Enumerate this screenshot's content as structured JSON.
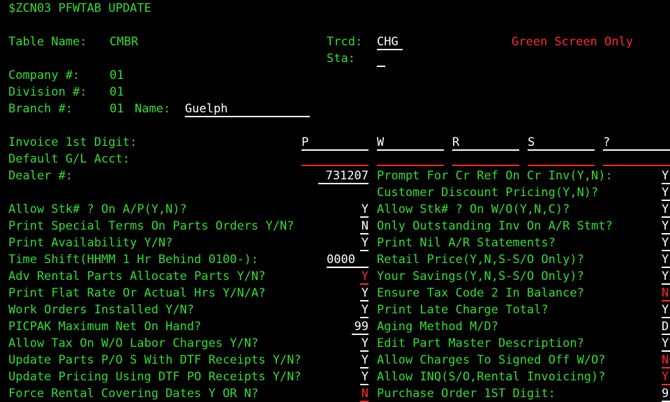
{
  "screen_title": "$ZCN03 PFWTAB UPDATE",
  "header": {
    "table_name_label": "Table Name:",
    "table_name_value": "CMBR",
    "trcd_label": "Trcd:",
    "trcd_value": "CHG",
    "sta_label": "Sta:",
    "sta_value": "",
    "notice": "Green Screen Only",
    "company_label": "Company #:",
    "company_value": "01",
    "division_label": "Division #:",
    "division_value": "01",
    "branch_label": "Branch #:",
    "branch_value": "01",
    "name_label": "Name:",
    "name_value": "Guelph"
  },
  "invoice": {
    "label": "Invoice 1st Digit:",
    "digits": [
      "P",
      "W",
      "R",
      "S",
      "?"
    ]
  },
  "gl_label": "Default G/L Acct:",
  "dealer": {
    "label": "Dealer #:",
    "value": "731207"
  },
  "left_options": [
    {
      "label": "Allow Stk# ? On A/P(Y,N)?",
      "value": "Y"
    },
    {
      "label": "Print Special Terms On Parts Orders Y/N?",
      "value": "N"
    },
    {
      "label": "Print Availability Y/N?",
      "value": "Y"
    },
    {
      "label": "Time Shift(HHMM 1 Hr Behind 0100-):",
      "value": "0000"
    },
    {
      "label": "Adv Rental Parts Allocate Parts Y/N?",
      "value": "Y"
    },
    {
      "label": "Print Flat Rate Or Actual Hrs Y/N/A?",
      "value": "Y"
    },
    {
      "label": "Work Orders Installed Y/N?",
      "value": "Y"
    },
    {
      "label": "PICPAK Maximum Net On Hand?",
      "value": "99"
    },
    {
      "label": "Allow Tax On W/O Labor Charges Y/N?",
      "value": "Y"
    },
    {
      "label": "Update Parts P/O S With DTF Receipts Y/N?",
      "value": "Y"
    },
    {
      "label": "Update Pricing Using DTF PO Receipts Y/N?",
      "value": "Y"
    },
    {
      "label": "Force Rental Covering Dates Y OR N?",
      "value": "N"
    }
  ],
  "right_options": [
    {
      "label": "Prompt For Cr Ref On Cr Inv(Y,N):",
      "value": "Y"
    },
    {
      "label": "Customer Discount Pricing(Y,N)?",
      "value": "Y"
    },
    {
      "label": "Allow Stk# ? On W/O(Y,N,C)?",
      "value": "Y"
    },
    {
      "label": "Only Outstanding Inv On A/R Stmt?",
      "value": "Y"
    },
    {
      "label": "Print Nil A/R Statements?",
      "value": "Y"
    },
    {
      "label": "Retail Price(Y,N,S-S/O Only)?",
      "value": "Y"
    },
    {
      "label": "Your Savings(Y,N,S-S/O Only)?",
      "value": "Y"
    },
    {
      "label": "Ensure Tax Code 2 In Balance?",
      "value": "N"
    },
    {
      "label": "Print Late Charge Total?",
      "value": "Y"
    },
    {
      "label": "Aging Method M/D?",
      "value": "D"
    },
    {
      "label": "Edit Part Master Description?",
      "value": "Y"
    },
    {
      "label": "Allow Charges To Signed Off W/O?",
      "value": "N"
    },
    {
      "label": "Allow INQ(S/O,Rental Invoicing)?",
      "value": "Y"
    },
    {
      "label": "Purchase Order 1ST Digit:",
      "value": "9"
    }
  ],
  "colors": {
    "background": "#000000",
    "text": "#33dd33",
    "field": "#ffffff",
    "alert": "#ff2a2a"
  }
}
